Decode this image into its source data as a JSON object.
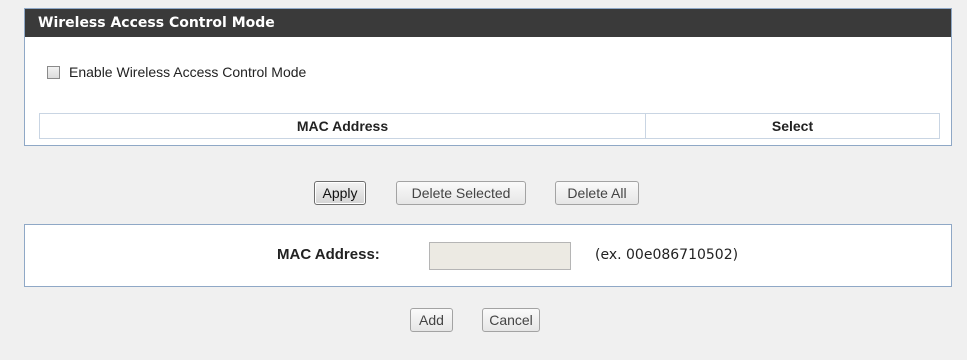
{
  "access_control": {
    "title": "Wireless Access Control Mode",
    "enable_label": "Enable Wireless Access Control Mode",
    "enable_checked": false,
    "table": {
      "columns": [
        "MAC Address",
        "Select"
      ],
      "rows": []
    }
  },
  "actions": {
    "apply_label": "Apply",
    "delete_selected_label": "Delete Selected",
    "delete_all_label": "Delete All"
  },
  "mac_entry": {
    "label": "MAC Address:",
    "value": "",
    "hint": "(ex. 00e086710502)",
    "add_label": "Add",
    "cancel_label": "Cancel"
  }
}
